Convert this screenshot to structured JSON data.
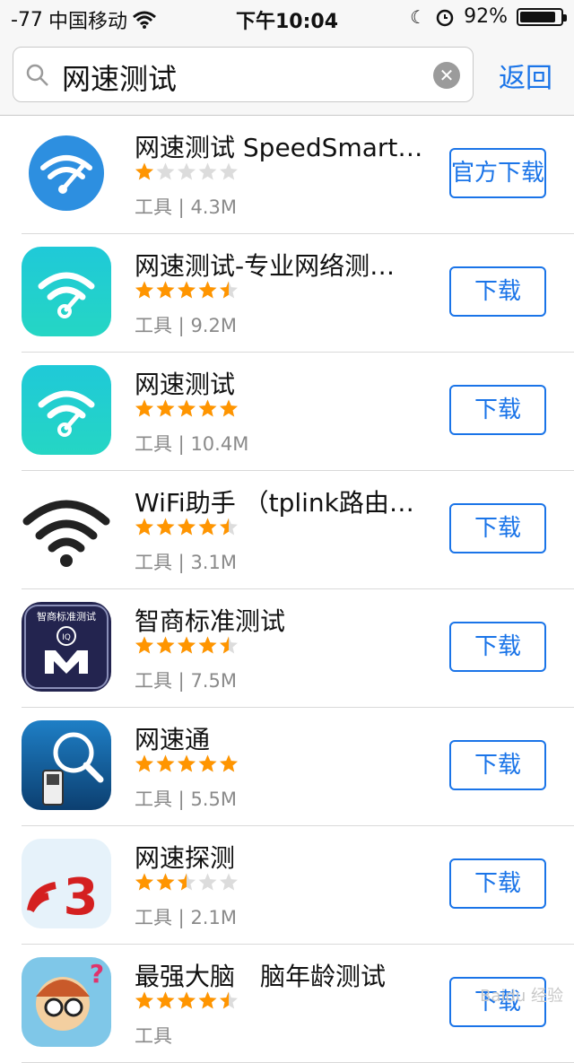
{
  "status": {
    "signal": "-77",
    "carrier": "中国移动",
    "time": "下午10:04",
    "battery": "92%",
    "battery_level": 0.92
  },
  "search": {
    "query": "网速测试",
    "back_label": "返回"
  },
  "apps": [
    {
      "title": "网速测试 SpeedSmart…",
      "rating": 1,
      "category": "工具",
      "size": "4.3M",
      "button": "官方下载",
      "icon": "speedsmart-wifi-gauge-icon"
    },
    {
      "title": "网速测试-专业网络测…",
      "rating": 4.5,
      "category": "工具",
      "size": "9.2M",
      "button": "下载",
      "icon": "teal-wifi-icon"
    },
    {
      "title": "网速测试",
      "rating": 5,
      "category": "工具",
      "size": "10.4M",
      "button": "下载",
      "icon": "teal-wifi-icon"
    },
    {
      "title": "WiFi助手 （tplink路由…",
      "rating": 4.5,
      "category": "工具",
      "size": "3.1M",
      "button": "下载",
      "icon": "black-wifi-icon"
    },
    {
      "title": "智商标准测试",
      "rating": 4.5,
      "category": "工具",
      "size": "7.5M",
      "button": "下载",
      "icon": "iq-test-icon",
      "icon_text": "智商标准测试"
    },
    {
      "title": "网速通",
      "rating": 5,
      "category": "工具",
      "size": "5.5M",
      "button": "下载",
      "icon": "magnifier-phone-icon"
    },
    {
      "title": "网速探测",
      "rating": 2.5,
      "category": "工具",
      "size": "2.1M",
      "button": "下载",
      "icon": "red-signal-3-icon"
    },
    {
      "title": "最强大脑　脑年龄测试",
      "rating": 4.5,
      "category": "工具",
      "size": "",
      "button": "下载",
      "icon": "cartoon-kid-icon"
    }
  ],
  "colors": {
    "accent": "#1a74e8",
    "star": "#ff9500",
    "star_empty": "#dcdcdc"
  }
}
